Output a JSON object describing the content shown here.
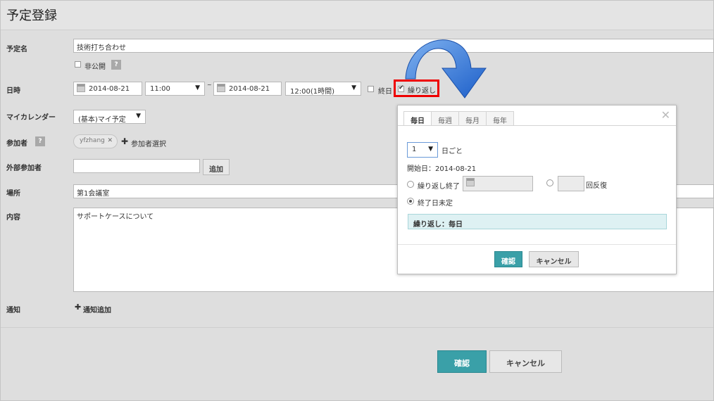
{
  "page": {
    "title": "予定登録"
  },
  "form": {
    "subject": {
      "label": "予定名",
      "value": "技術打ち合わせ"
    },
    "private": {
      "label": "非公開",
      "help": "?"
    },
    "datetime": {
      "label": "日時",
      "start_date": "2014-08-21",
      "start_time": "11:00",
      "separator": "~",
      "end_date": "2014-08-21",
      "end_time": "12:00(1時間)",
      "allday_label": "終日",
      "repeat_label": "繰り返し"
    },
    "calendar": {
      "label": "マイカレンダー",
      "value": "(基本)マイ予定"
    },
    "attendees": {
      "label": "参加者",
      "help": "?",
      "tag": "yfzhang",
      "tag_remove": "✕",
      "select_label": "参加者選択"
    },
    "external": {
      "label": "外部参加者",
      "add_label": "追加"
    },
    "location": {
      "label": "場所",
      "value": "第1会議室"
    },
    "content": {
      "label": "内容",
      "value": "サポートケースについて"
    },
    "notify": {
      "label": "通知",
      "add_label": "通知追加"
    }
  },
  "footer": {
    "confirm_label": "確認",
    "cancel_label": "キャンセル"
  },
  "repeat_popup": {
    "tabs": [
      "毎日",
      "毎週",
      "毎月",
      "毎年"
    ],
    "active_tab": 0,
    "close_glyph": "✕",
    "interval": {
      "value": "1",
      "suffix": "日ごと"
    },
    "start_date_text": "開始日：2014-08-21",
    "end_option_label": "繰り返し終了",
    "count_suffix": "回反復",
    "no_end_label": "終了日未定",
    "summary": "繰り返し：毎日",
    "confirm_label": "確認",
    "cancel_label": "キャンセル"
  },
  "colors": {
    "primary": "#3aa0a8",
    "highlight": "#ee0000",
    "arrow": "#2f6fd6"
  }
}
